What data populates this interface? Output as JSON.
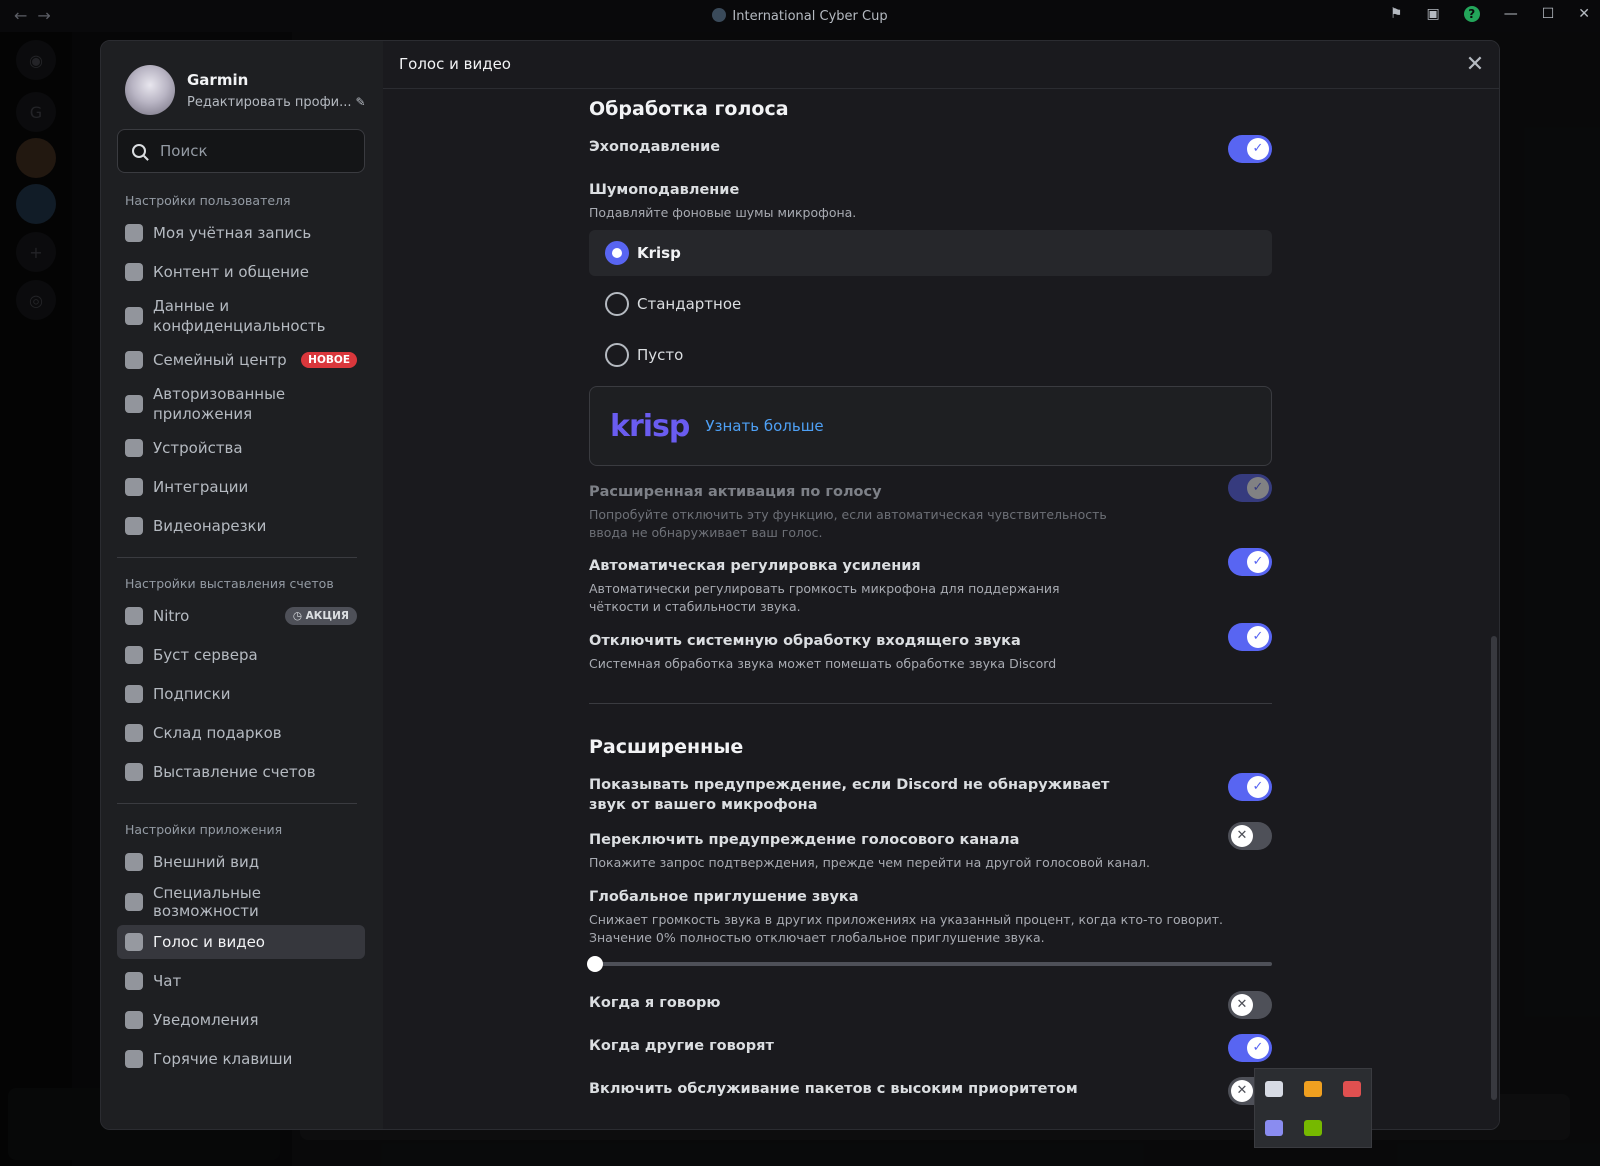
{
  "titlebar": {
    "server_name": "International Cyber Cup"
  },
  "profile": {
    "name": "Garmin",
    "edit_label": "Редактировать профи..."
  },
  "search": {
    "placeholder": "Поиск"
  },
  "nav": {
    "user_settings_header": "Настройки пользователя",
    "user_items": [
      {
        "label": "Моя учётная запись",
        "icon": "user-icon"
      },
      {
        "label": "Контент и общение",
        "icon": "content-icon"
      },
      {
        "label": "Данные и конфиденциальность",
        "icon": "shield-icon"
      },
      {
        "label": "Семейный центр",
        "icon": "family-icon",
        "badge": "НОВОЕ"
      },
      {
        "label": "Авторизованные приложения",
        "icon": "puzzle-icon"
      },
      {
        "label": "Устройства",
        "icon": "devices-icon"
      },
      {
        "label": "Интеграции",
        "icon": "link-icon"
      },
      {
        "label": "Видеонарезки",
        "icon": "clapper-icon"
      }
    ],
    "billing_header": "Настройки выставления счетов",
    "billing_items": [
      {
        "label": "Nitro",
        "icon": "nitro-icon",
        "badge": "АКЦИЯ"
      },
      {
        "label": "Буст сервера",
        "icon": "boost-icon"
      },
      {
        "label": "Подписки",
        "icon": "subscriptions-icon"
      },
      {
        "label": "Склад подарков",
        "icon": "gift-icon"
      },
      {
        "label": "Выставление счетов",
        "icon": "card-icon"
      }
    ],
    "app_header": "Настройки приложения",
    "app_items": [
      {
        "label": "Внешний вид",
        "icon": "palette-icon"
      },
      {
        "label": "Специальные возможности",
        "icon": "accessibility-icon"
      },
      {
        "label": "Голос и видео",
        "icon": "mic-icon",
        "active": true
      },
      {
        "label": "Чат",
        "icon": "chat-icon"
      },
      {
        "label": "Уведомления",
        "icon": "bell-icon"
      },
      {
        "label": "Горячие клавиши",
        "icon": "keyboard-icon"
      }
    ]
  },
  "content": {
    "header_title": "Голос и видео",
    "voice_processing": {
      "title": "Обработка голоса",
      "echo_label": "Эхоподавление",
      "echo_on": true,
      "noise_label": "Шумоподавление",
      "noise_desc": "Подавляйте фоновые шумы микрофона.",
      "noise_options": [
        "Krisp",
        "Стандартное",
        "Пусто"
      ],
      "noise_selected": "Krisp",
      "krisp_logo": "krisp",
      "krisp_link": "Узнать больше",
      "adv_vad_label": "Расширенная активация по голосу",
      "adv_vad_desc": "Попробуйте отключить эту функцию, если автоматическая чувствительность ввода не обнаруживает ваш голос.",
      "adv_vad_on": true,
      "agc_label": "Автоматическая регулировка усиления",
      "agc_desc": "Автоматически регулировать громкость микрофона для поддержания чёткости и стабильности звука.",
      "agc_on": true,
      "sys_label": "Отключить системную обработку входящего звука",
      "sys_desc": "Системная обработка звука может помешать обработке звука Discord",
      "sys_on": true
    },
    "advanced": {
      "title": "Расширенные",
      "warn_label": "Показывать предупреждение, если Discord не обнаруживает звук от вашего микрофона",
      "warn_on": true,
      "switch_label": "Переключить предупреждение голосового канала",
      "switch_desc": "Покажите запрос подтверждения, прежде чем перейти на другой голосовой канал.",
      "switch_on": false,
      "duck_label": "Глобальное приглушение звука",
      "duck_desc": "Снижает громкость звука в других приложениях на указанный процент, когда кто-то говорит. Значение 0% полностью отключает глобальное приглушение звука.",
      "duck_value": 0,
      "when_i_label": "Когда я говорю",
      "when_i_on": false,
      "when_others_label": "Когда другие говорят",
      "when_others_on": true,
      "qos_label": "Включить обслуживание пакетов с высоким приоритетом",
      "qos_on": false
    }
  },
  "colors": {
    "accent": "#5865f2",
    "danger": "#da373c",
    "link": "#4ea0f5"
  }
}
